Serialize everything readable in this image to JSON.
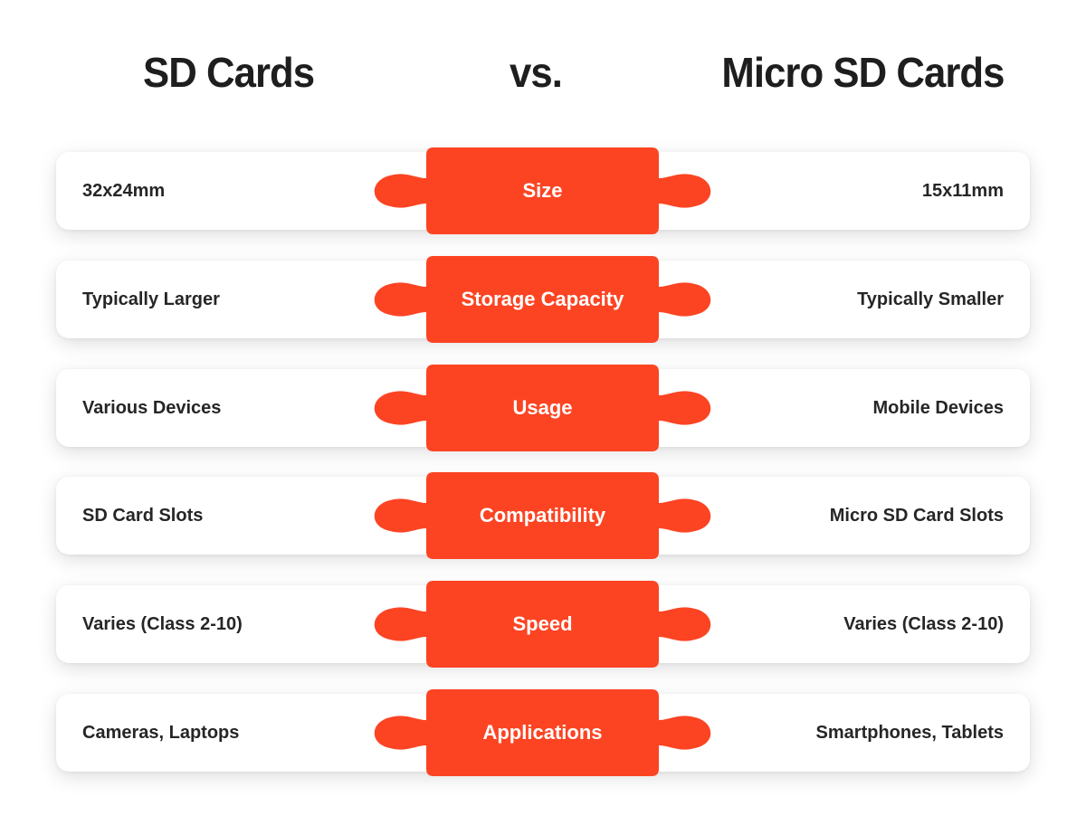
{
  "header": {
    "left_title": "SD Cards",
    "vs_label": "vs.",
    "right_title": "Micro SD Cards"
  },
  "colors": {
    "accent": "#fc4423",
    "card_bg": "#ffffff",
    "text": "#262626"
  },
  "rows": [
    {
      "category": "Size",
      "sd": "32x24mm",
      "micro_sd": "15x11mm"
    },
    {
      "category": "Storage Capacity",
      "sd": "Typically Larger",
      "micro_sd": "Typically Smaller"
    },
    {
      "category": "Usage",
      "sd": "Various Devices",
      "micro_sd": "Mobile Devices"
    },
    {
      "category": "Compatibility",
      "sd": "SD Card Slots",
      "micro_sd": "Micro SD Card Slots"
    },
    {
      "category": "Speed",
      "sd": "Varies (Class 2-10)",
      "micro_sd": "Varies (Class 2-10)"
    },
    {
      "category": "Applications",
      "sd": "Cameras, Laptops",
      "micro_sd": "Smartphones, Tablets"
    }
  ]
}
